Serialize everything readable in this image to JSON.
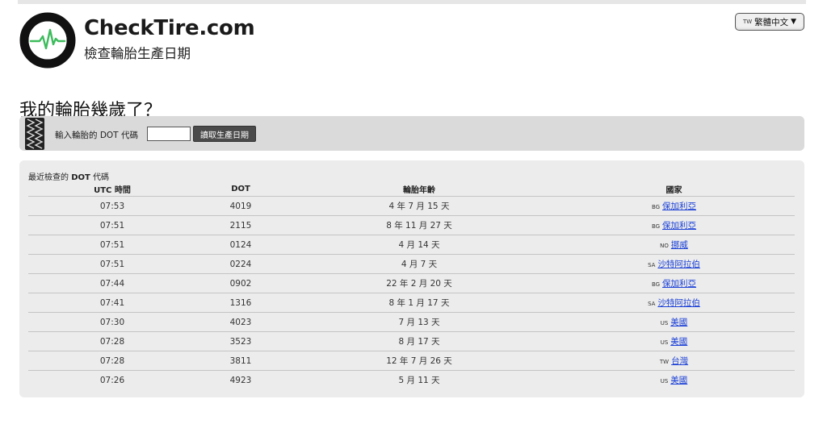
{
  "header": {
    "brand_name": "CheckTire.com",
    "tagline": "檢查輪胎生產日期",
    "language": {
      "code": "TW",
      "label": "繁體中文"
    }
  },
  "page_title": "我的輪胎幾歲了？",
  "search": {
    "label": "輸入輪胎的 DOT 代碼",
    "input_value": "",
    "button_label": "讀取生產日期"
  },
  "recent": {
    "title_prefix": "最近檢查的 ",
    "title_dot": "DOT",
    "title_suffix": " 代碼",
    "columns": [
      "UTC 時間",
      "DOT",
      "輪胎年齡",
      "國家"
    ],
    "rows": [
      {
        "time": "07:53",
        "dot": "4019",
        "age": "4 年 7 月 15 天",
        "cc": "BG",
        "country": "保加利亞"
      },
      {
        "time": "07:51",
        "dot": "2115",
        "age": "8 年 11 月 27 天",
        "cc": "BG",
        "country": "保加利亞"
      },
      {
        "time": "07:51",
        "dot": "0124",
        "age": "4 月 14 天",
        "cc": "NO",
        "country": "挪威"
      },
      {
        "time": "07:51",
        "dot": "0224",
        "age": "4 月 7 天",
        "cc": "SA",
        "country": "沙特阿拉伯"
      },
      {
        "time": "07:44",
        "dot": "0902",
        "age": "22 年 2 月 20 天",
        "cc": "BG",
        "country": "保加利亞"
      },
      {
        "time": "07:41",
        "dot": "1316",
        "age": "8 年 1 月 17 天",
        "cc": "SA",
        "country": "沙特阿拉伯"
      },
      {
        "time": "07:30",
        "dot": "4023",
        "age": "7 月 13 天",
        "cc": "US",
        "country": "美國"
      },
      {
        "time": "07:28",
        "dot": "3523",
        "age": "8 月 17 天",
        "cc": "US",
        "country": "美國"
      },
      {
        "time": "07:28",
        "dot": "3811",
        "age": "12 年 7 月 26 天",
        "cc": "TW",
        "country": "台灣"
      },
      {
        "time": "07:26",
        "dot": "4923",
        "age": "5 月 11 天",
        "cc": "US",
        "country": "美國"
      }
    ]
  },
  "colors": {
    "logo_ring": "#111111",
    "heartbeat": "#3dbb5c",
    "link": "#1a3fd6",
    "panel": "#dadada",
    "table_panel": "#ececec"
  }
}
